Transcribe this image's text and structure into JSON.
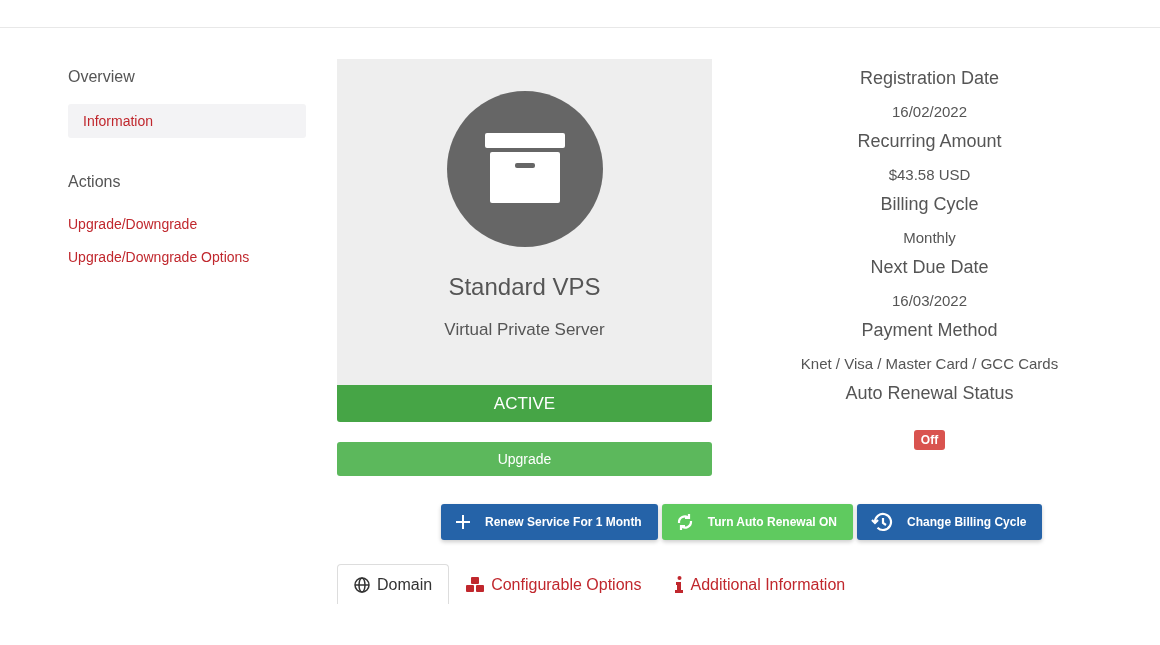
{
  "sidebar": {
    "sections": [
      {
        "heading": "Overview",
        "items": [
          {
            "label": "Information",
            "selected": true
          }
        ]
      },
      {
        "heading": "Actions",
        "items": [
          {
            "label": "Upgrade/Downgrade",
            "selected": false
          },
          {
            "label": "Upgrade/Downgrade Options",
            "selected": false
          }
        ]
      }
    ]
  },
  "product": {
    "name": "Standard VPS",
    "group": "Virtual Private Server",
    "status": "ACTIVE",
    "upgrade_button": "Upgrade"
  },
  "details": [
    {
      "label": "Registration Date",
      "value": "16/02/2022",
      "kind": "text"
    },
    {
      "label": "Recurring Amount",
      "value": "$43.58 USD",
      "kind": "text"
    },
    {
      "label": "Billing Cycle",
      "value": "Monthly",
      "kind": "text"
    },
    {
      "label": "Next Due Date",
      "value": "16/03/2022",
      "kind": "text"
    },
    {
      "label": "Payment Method",
      "value": "Knet / Visa / Master Card / GCC Cards",
      "kind": "text"
    },
    {
      "label": "Auto Renewal Status",
      "value": "Off",
      "kind": "badge"
    }
  ],
  "actions": [
    {
      "label": "Renew Service For 1 Month",
      "kind": "primary"
    },
    {
      "label": "Turn Auto Renewal ON",
      "kind": "success"
    },
    {
      "label": "Change Billing Cycle",
      "kind": "primary"
    }
  ],
  "tabs": [
    {
      "label": "Domain",
      "selected": true
    },
    {
      "label": "Configurable Options",
      "selected": false
    },
    {
      "label": "Additional Information",
      "selected": false
    }
  ]
}
